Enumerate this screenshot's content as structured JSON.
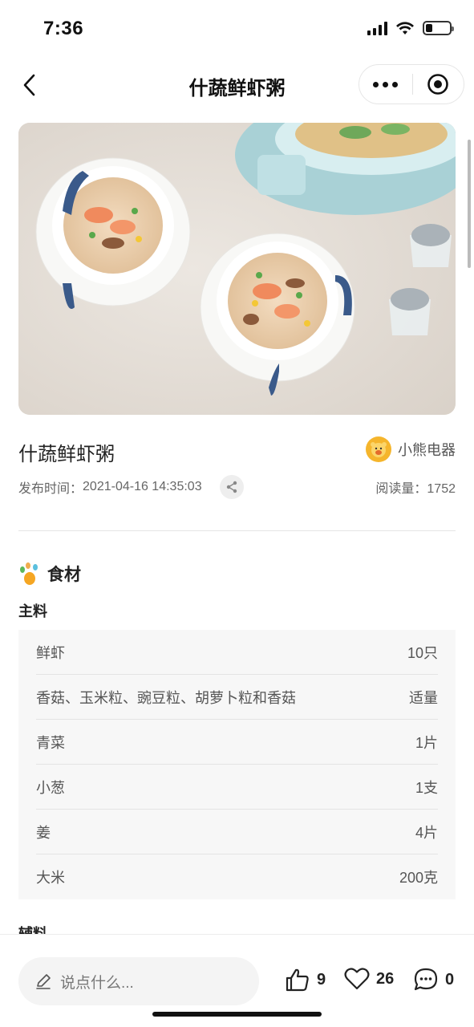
{
  "status": {
    "time": "7:36"
  },
  "nav": {
    "title": "什蔬鲜虾粥"
  },
  "recipe": {
    "title": "什蔬鲜虾粥",
    "author": "小熊电器",
    "publish_label": "发布时间：",
    "publish_time": "2021-04-16 14:35:03",
    "read_count": "阅读量：1752"
  },
  "ingredients": {
    "section_title": "食材",
    "main_label": "主料",
    "main_items": [
      {
        "name": "鲜虾",
        "qty": "10只"
      },
      {
        "name": "香菇、玉米粒、豌豆粒、胡萝卜粒和香菇",
        "qty": "适量"
      },
      {
        "name": "青菜",
        "qty": "1片"
      },
      {
        "name": "小葱",
        "qty": "1支"
      },
      {
        "name": "姜",
        "qty": "4片"
      },
      {
        "name": "大米",
        "qty": "200克"
      }
    ],
    "secondary_label": "辅料"
  },
  "bottom": {
    "comment_placeholder": "说点什么...",
    "likes": "9",
    "favorites": "26",
    "comments": "0"
  },
  "colors": {
    "accent_orange": "#f5a623",
    "text_dark": "#222222",
    "text_gray": "#666666"
  }
}
